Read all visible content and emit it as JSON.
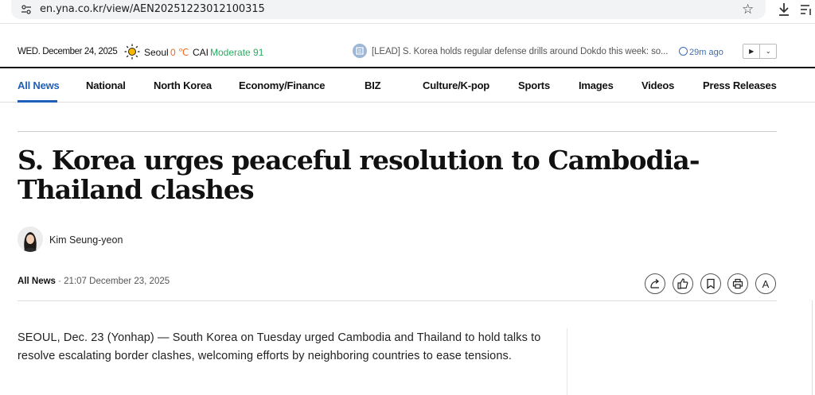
{
  "browser": {
    "url": "en.yna.co.kr/view/AEN20251223012100315"
  },
  "info_bar": {
    "date": "WED. December 24, 2025",
    "weather_city": "Seoul",
    "weather_temp": "0 ℃",
    "cai_label": "CAI",
    "cai_status": "Moderate 91",
    "ticker_headline": "[LEAD] S. Korea holds regular defense drills around Dokdo this week: so...",
    "ticker_time": "29m ago"
  },
  "nav": {
    "items": [
      {
        "label": "All News"
      },
      {
        "label": "National"
      },
      {
        "label": "North Korea"
      },
      {
        "label": "Economy/Finance"
      },
      {
        "label": "BIZ"
      },
      {
        "label": "Culture/K-pop"
      },
      {
        "label": "Sports"
      },
      {
        "label": "Images"
      },
      {
        "label": "Videos"
      },
      {
        "label": "Press Releases"
      }
    ],
    "active": "All News"
  },
  "article": {
    "headline": "S. Korea urges peaceful resolution to Cambodia-Thailand clashes",
    "author": "Kim Seung-yeon",
    "section": "All News",
    "timestamp": "· 21:07 December 23, 2025",
    "body": "SEOUL, Dec. 23 (Yonhap) — South Korea on Tuesday urged Cambodia and Thailand to hold talks to resolve escalating border clashes, welcoming efforts by neighboring countries to ease tensions."
  },
  "tools": {
    "font_size_label": "A",
    "icons": [
      "share-icon",
      "like-icon",
      "bookmark-icon",
      "print-icon",
      "font-size-icon"
    ]
  },
  "colors": {
    "accent": "#1f5fb8",
    "temp": "#f26522",
    "cai_good": "#27ae60"
  }
}
